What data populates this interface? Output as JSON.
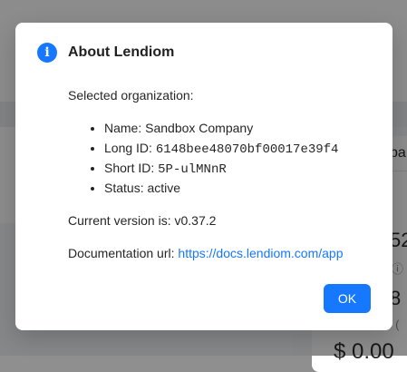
{
  "background": {
    "card_title": "ba",
    "value_1": "52",
    "value_2": "8",
    "sub_1": "ⓘ",
    "sub_2": "s (",
    "amount": "$ 0.00"
  },
  "dialog": {
    "icon": "info-icon",
    "title": "About Lendiom",
    "selected_label": "Selected organization:",
    "details": [
      {
        "label": "Name: ",
        "value": "Sandbox Company",
        "mono": false
      },
      {
        "label": "Long ID: ",
        "value": "6148bee48070bf00017e39f4",
        "mono": true
      },
      {
        "label": "Short ID: ",
        "value": "5P-ulMNnR",
        "mono": true
      },
      {
        "label": "Status: ",
        "value": "active",
        "mono": false
      }
    ],
    "version_text": "Current version is: v0.37.2",
    "doc_label": "Documentation url: ",
    "doc_url": "https://docs.lendiom.com/app",
    "ok_label": "OK"
  },
  "colors": {
    "accent": "#1677ff",
    "overlay": "rgba(0,0,0,0.45)"
  }
}
